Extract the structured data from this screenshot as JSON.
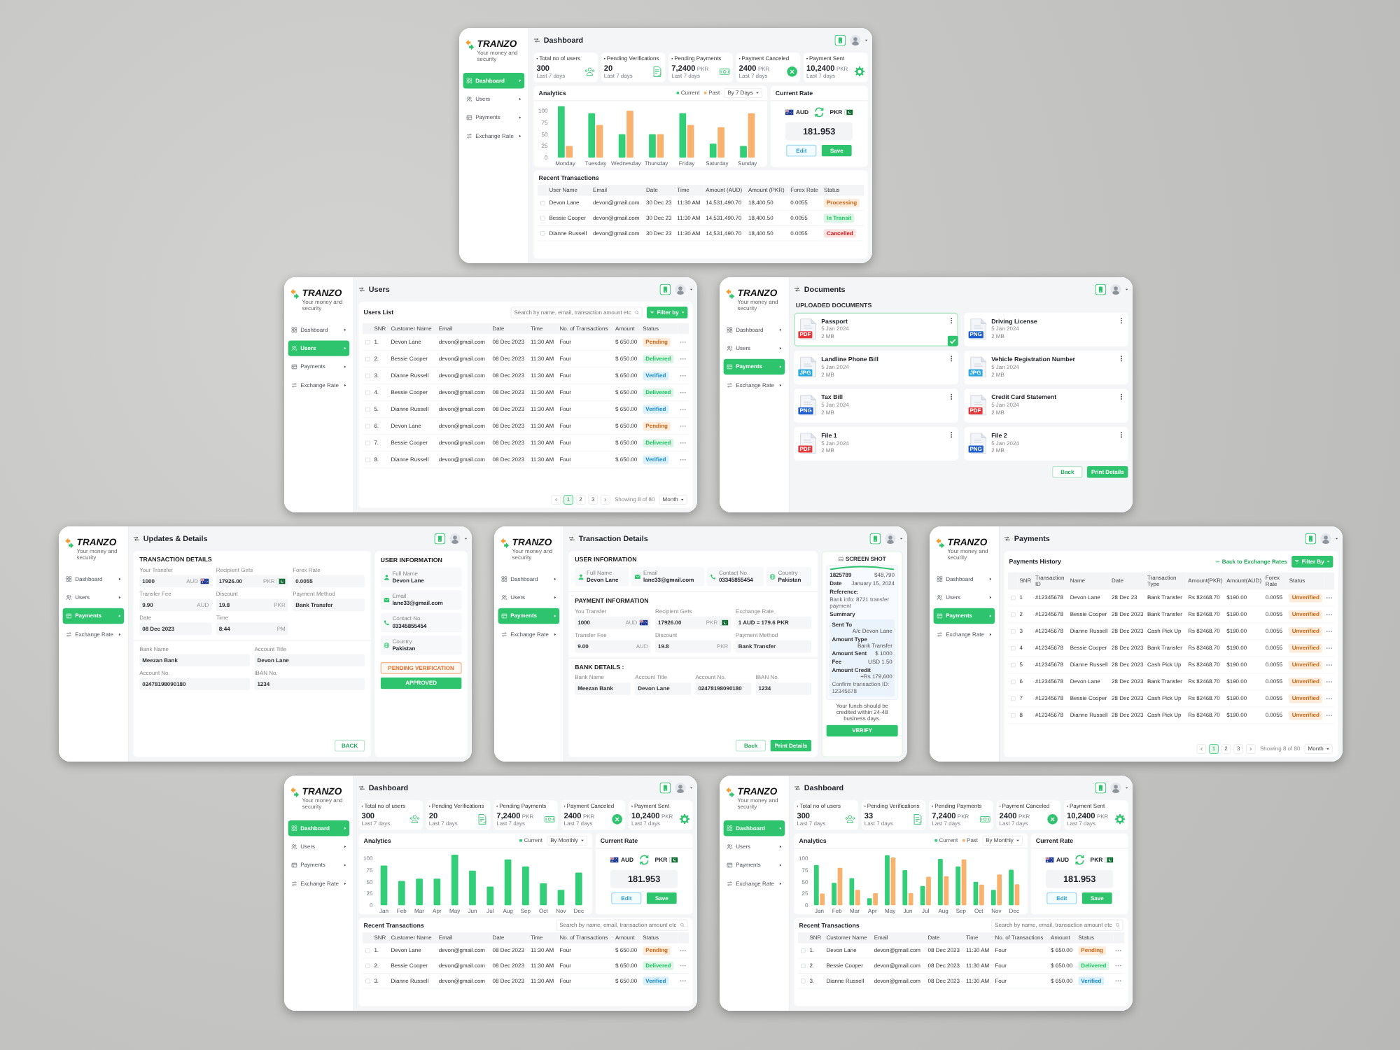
{
  "screen_rows": [
    [
      {
        "kind": "dashboard",
        "logo": {
          "name": "TRANZO",
          "tagline": "Your money and security"
        },
        "sidebar": [
          {
            "label": "Dashboard",
            "selected": true
          },
          {
            "label": "Users",
            "selected": false
          },
          {
            "label": "Payments",
            "selected": false
          },
          {
            "label": "Exchange Rate",
            "selected": false
          }
        ],
        "title": "Dashboard",
        "stats": [
          {
            "label": "Total no of users",
            "value": "300",
            "note": "Last 7 days"
          },
          {
            "label": "Pending Verifications",
            "value": "20",
            "note": "Last 7 days"
          },
          {
            "label": "Pending Payments",
            "value": "7,2400",
            "unit": "PKR",
            "note": "Last 7 days"
          },
          {
            "label": "Payment Canceled",
            "value": "2400",
            "unit": "PKR",
            "note": "Last 7 days"
          },
          {
            "label": "Payment Sent",
            "value": "10,2400",
            "unit": "PKR",
            "note": "Last 7 days"
          }
        ],
        "analytics": {
          "title": "Analytics",
          "period": "By 7 Days",
          "chart_data": {
            "type": "bar",
            "categories": [
              "Monday",
              "Tuesday",
              "Wednesday",
              "Thursday",
              "Friday",
              "Saturday",
              "Sunday"
            ],
            "series": [
              {
                "name": "Current",
                "color": "#33cf78",
                "values": [
                  110,
                  95,
                  50,
                  50,
                  95,
                  30,
                  25
                ]
              },
              {
                "name": "Past",
                "color": "#f9b26e",
                "values": [
                  25,
                  70,
                  100,
                  50,
                  70,
                  65,
                  95
                ]
              }
            ],
            "yticks": [
              0,
              25,
              50,
              75,
              100
            ],
            "ylim": [
              0,
              110
            ]
          }
        },
        "rate": {
          "title": "Current Rate",
          "from": "AUD",
          "to": "PKR",
          "value": "181.953",
          "buttons": [
            {
              "label": "Edit",
              "kind": "secondary"
            },
            {
              "label": "Save",
              "kind": "primary"
            }
          ]
        },
        "transactions": {
          "title": "Recent Transactions",
          "columns": [
            "User Name",
            "Email",
            "Date",
            "Time",
            "Amount (AUD)",
            "Amount (PKR)",
            "Forex Rate",
            "Status"
          ],
          "rows": [
            {
              "checked": false,
              "cells": [
                "Devon Lane",
                "devon@gmail.com",
                "30 Dec 23",
                "11:30 AM",
                "14,531,490.70",
                "18,400.50",
                "0.0055"
              ],
              "status": {
                "label": "Processing",
                "color": "#fdebdb"
              }
            },
            {
              "checked": false,
              "cells": [
                "Bessie Cooper",
                "devon@gmail.com",
                "30 Dec 23",
                "11:30 AM",
                "14,531,490.70",
                "18,400.50",
                "0.0055"
              ],
              "status": {
                "label": "In Transit",
                "color": "#dcf5e6"
              }
            },
            {
              "checked": false,
              "cells": [
                "Dianne Russell",
                "devon@gmail.com",
                "30 Dec 23",
                "11:30 AM",
                "14,531,490.70",
                "18,400.50",
                "0.0055"
              ],
              "status": {
                "label": "Cancelled",
                "color": "#fde2e2"
              }
            }
          ]
        }
      }
    ],
    [
      {
        "kind": "table",
        "logo": {
          "name": "TRANZO",
          "tagline": "Your money and security"
        },
        "sidebar": [
          {
            "label": "Dashboard",
            "selected": false
          },
          {
            "label": "Users",
            "selected": true
          },
          {
            "label": "Payments",
            "selected": false
          },
          {
            "label": "Exchange Rate",
            "selected": false
          }
        ],
        "title": "Users",
        "table": {
          "title": "Users List",
          "search": {
            "placeholder": "Search by name, email, transaction amount etc"
          },
          "filter": "Filter by",
          "columns": [
            "SNR",
            "Customer Name",
            "Email",
            "Date",
            "Time",
            "No. of Transactions",
            "Amount",
            "Status"
          ],
          "rows": [
            {
              "checked": false,
              "cells": [
                "1.",
                "Devon Lane",
                "devon@gmail.com",
                "08 Dec 2023",
                "11:30 AM",
                "Four",
                "$ 650.00"
              ],
              "status": {
                "label": "Pending",
                "color": "#fdebdb"
              }
            },
            {
              "checked": false,
              "cells": [
                "2.",
                "Bessie Cooper",
                "devon@gmail.com",
                "08 Dec 2023",
                "11:30 AM",
                "Four",
                "$ 650.00"
              ],
              "status": {
                "label": "Delivered",
                "color": "#dcf5e6"
              }
            },
            {
              "checked": false,
              "cells": [
                "3.",
                "Dianne Russell",
                "devon@gmail.com",
                "08 Dec 2023",
                "11:30 AM",
                "Four",
                "$ 650.00"
              ],
              "status": {
                "label": "Verified",
                "color": "#dcf0fb"
              }
            },
            {
              "checked": false,
              "cells": [
                "4.",
                "Bessie Cooper",
                "devon@gmail.com",
                "08 Dec 2023",
                "11:30 AM",
                "Four",
                "$ 650.00"
              ],
              "status": {
                "label": "Delivered",
                "color": "#dcf5e6"
              }
            },
            {
              "checked": false,
              "cells": [
                "5.",
                "Dianne Russell",
                "devon@gmail.com",
                "08 Dec 2023",
                "11:30 AM",
                "Four",
                "$ 650.00"
              ],
              "status": {
                "label": "Verified",
                "color": "#dcf0fb"
              }
            },
            {
              "checked": false,
              "cells": [
                "6.",
                "Devon Lane",
                "devon@gmail.com",
                "08 Dec 2023",
                "11:30 AM",
                "Four",
                "$ 650.00"
              ],
              "status": {
                "label": "Pending",
                "color": "#fdebdb"
              }
            },
            {
              "checked": false,
              "cells": [
                "7.",
                "Bessie Cooper",
                "devon@gmail.com",
                "08 Dec 2023",
                "11:30 AM",
                "Four",
                "$ 650.00"
              ],
              "status": {
                "label": "Delivered",
                "color": "#dcf5e6"
              }
            },
            {
              "checked": false,
              "cells": [
                "8.",
                "Dianne Russell",
                "devon@gmail.com",
                "08 Dec 2023",
                "11:30 AM",
                "Four",
                "$ 650.00"
              ],
              "status": {
                "label": "Verified",
                "color": "#dcf0fb"
              }
            }
          ],
          "pagination": {
            "pages": [
              {
                "label": "1",
                "selected": true
              },
              {
                "label": "2",
                "selected": false
              },
              {
                "label": "3",
                "selected": false
              }
            ],
            "summary": "Showing 8 of 80",
            "per_page": "Month"
          }
        }
      },
      {
        "kind": "documents",
        "logo": {
          "name": "TRANZO",
          "tagline": "Your money and security"
        },
        "sidebar": [
          {
            "label": "Dashboard",
            "selected": false
          },
          {
            "label": "Users",
            "selected": false
          },
          {
            "label": "Payments",
            "selected": true
          },
          {
            "label": "Exchange Rate",
            "selected": false
          }
        ],
        "title": "Documents",
        "section": "UPLOADED DOCUMENTS",
        "documents": [
          {
            "name": "Passport",
            "date": "5 Jan 2024",
            "size": "2 MB",
            "type": "PDF",
            "color": "#e5383b",
            "selected": true
          },
          {
            "name": "Driving License",
            "date": "5 Jan 2024",
            "size": "2 MB",
            "type": "PNG",
            "color": "#1d5fd0",
            "selected": false
          },
          {
            "name": "Landline Phone Bill",
            "date": "5 Jan 2024",
            "size": "2 MB",
            "type": "JPG",
            "color": "#2aa8e0",
            "selected": false
          },
          {
            "name": "Vehicle Registration Number",
            "date": "5 Jan 2024",
            "size": "2 MB",
            "type": "JPG",
            "color": "#2aa8e0",
            "selected": false
          },
          {
            "name": "Tax Bill",
            "date": "5 Jan 2024",
            "size": "2 MB",
            "type": "PNG",
            "color": "#1d5fd0",
            "selected": false
          },
          {
            "name": "Credit Card Statement",
            "date": "5 Jan 2024",
            "size": "2 MB",
            "type": "PDF",
            "color": "#e5383b",
            "selected": false
          },
          {
            "name": "File 1",
            "date": "5 Jan 2024",
            "size": "2 MB",
            "type": "PDF",
            "color": "#e5383b",
            "selected": false
          },
          {
            "name": "File 2",
            "date": "5 Jan 2024",
            "size": "2 MB",
            "type": "PNG",
            "color": "#1d5fd0",
            "selected": false
          }
        ],
        "buttons": [
          {
            "label": "Back",
            "kind": "outline"
          },
          {
            "label": "Print Details",
            "kind": "primary"
          }
        ]
      }
    ],
    [
      {
        "kind": "details",
        "logo": {
          "name": "TRANZO",
          "tagline": "Your money and security"
        },
        "sidebar": [
          {
            "label": "Dashboard",
            "selected": false
          },
          {
            "label": "Users",
            "selected": false
          },
          {
            "label": "Payments",
            "selected": true
          },
          {
            "label": "Exchange Rate",
            "selected": false
          }
        ],
        "title": "Updates & Details",
        "transaction_details": {
          "title": "TRANSACTION DETAILS",
          "fields": [
            {
              "kind": "australia",
              "label": "Your Transfer",
              "value": "1000",
              "unit": "AUD"
            },
            {
              "kind": "pakistan",
              "label": "Recipient Gets",
              "value": "17926.00",
              "unit": "PKR"
            },
            {
              "kind": "plain",
              "label": "Forex Rate",
              "value": "0.0055"
            },
            {
              "kind": "plain",
              "label": "Transfer Fee",
              "value": "9.90",
              "unit": "AUD"
            },
            {
              "kind": "plain",
              "label": "Discount",
              "value": "19.8",
              "unit": "PKR"
            },
            {
              "kind": "plain",
              "label": "Payment Method",
              "value": "Bank Transfer"
            },
            {
              "kind": "plain",
              "label": "Date",
              "value": "08 Dec 2023"
            },
            {
              "kind": "plain",
              "label": "Time",
              "value": "8:44",
              "unit": "PM"
            }
          ]
        },
        "bank": {
          "fields": [
            {
              "label": "Bank Name",
              "value": "Meezan Bank"
            },
            {
              "label": "Account Title",
              "value": "Devon Lane"
            },
            {
              "label": "Account No.",
              "value": "02478198090180"
            },
            {
              "label": "IBAN No.",
              "value": "1234"
            }
          ]
        },
        "back": {
          "label": "BACK",
          "kind": "outline"
        },
        "user": {
          "title": "USER INFORMATION",
          "fields": [
            {
              "label": "Full Name",
              "value": "Devon Lane"
            },
            {
              "label": "Email",
              "value": "lane33@gmail.com"
            },
            {
              "label": "Contact No.",
              "value": "03345855454"
            },
            {
              "label": "Country",
              "value": "Pakistan"
            }
          ],
          "buttons": [
            {
              "label": "PENDING VERIFICATION",
              "kind": "warning"
            },
            {
              "label": "APPROVED",
              "kind": "primary"
            }
          ]
        }
      },
      {
        "kind": "transaction",
        "logo": {
          "name": "TRANZO",
          "tagline": "Your money and security"
        },
        "sidebar": [
          {
            "label": "Dashboard",
            "selected": false
          },
          {
            "label": "Users",
            "selected": false
          },
          {
            "label": "Payments",
            "selected": true
          },
          {
            "label": "Exchange Rate",
            "selected": false
          }
        ],
        "title": "Transaction Details",
        "user": {
          "title": "USER INFORMATION",
          "fields": [
            {
              "label": "Full Name",
              "value": "Devon Lane"
            },
            {
              "label": "Email",
              "value": "lane33@gmail.com"
            },
            {
              "label": "Contact No.",
              "value": "03345855454"
            },
            {
              "label": "Country",
              "value": "Pakistan"
            }
          ]
        },
        "payment": {
          "title": "PAYMENT INFORMATION",
          "fields": [
            {
              "kind": "australia",
              "label": "You Transfer",
              "value": "1000",
              "unit": "AUD"
            },
            {
              "kind": "pakistan",
              "label": "Recipient Gets",
              "value": "17926.00",
              "unit": "PKR"
            },
            {
              "kind": "plain",
              "label": "Exchange Rate",
              "value": "1 AUD = 179.6 PKR"
            },
            {
              "kind": "plain",
              "label": "Transfer Fee",
              "value": "9.00",
              "unit": "AUD"
            },
            {
              "kind": "plain",
              "label": "Discount",
              "value": "19.8",
              "unit": "PKR"
            },
            {
              "kind": "plain",
              "label": "Payment Method",
              "value": "Bank Transfer"
            }
          ]
        },
        "bank": {
          "title": "BANK DETAILS :",
          "fields": [
            {
              "label": "Bank Name",
              "value": "Meezan Bank"
            },
            {
              "label": "Account Title",
              "value": "Devon Lane"
            },
            {
              "label": "Account No.",
              "value": "02478198090180"
            },
            {
              "label": "IBAN No.",
              "value": "1234"
            }
          ]
        },
        "buttons": [
          {
            "label": "Back",
            "kind": "outline"
          },
          {
            "label": "Print Details",
            "kind": "primary"
          }
        ],
        "receipt": {
          "title": "SCREEN SHOT",
          "head": [
            {
              "label": "1825789",
              "value": "$48,790"
            },
            {
              "label": "Date",
              "value": "January 15, 2024"
            }
          ],
          "reference": {
            "label": "Reference:",
            "text": "Bank info: 8721 transfer payment"
          },
          "summary_title": "Summary",
          "summary": [
            {
              "label": "Sent To",
              "value": "A/c Devon Lane"
            },
            {
              "label": "Amount Type",
              "value": "Bank Transfer"
            },
            {
              "label": "Amount Sent",
              "value": "$ 1000"
            },
            {
              "label": "Fee",
              "value": "USD 1.50"
            },
            {
              "label": "Amount Credit",
              "value": "+Rs 179,600"
            }
          ],
          "note": "Confirm transaction ID: 12345678",
          "footer": "Your funds should be credited within 24-48 business days.",
          "button": "VERIFY"
        }
      },
      {
        "kind": "table",
        "logo": {
          "name": "TRANZO",
          "tagline": "Your money and security"
        },
        "sidebar": [
          {
            "label": "Dashboard",
            "selected": false
          },
          {
            "label": "Users",
            "selected": false
          },
          {
            "label": "Payments",
            "selected": true
          },
          {
            "label": "Exchange Rate",
            "selected": false
          }
        ],
        "title": "Payments",
        "table": {
          "title": "Payments History",
          "link": "Back to Exchange Rates",
          "filter": "Filter By",
          "columns": [
            "SNR",
            "Transaction ID",
            "Name",
            "Date",
            "Transaction Type",
            "Amount(PKR)",
            "Amount(AUD)",
            "Forex Rate",
            "Status"
          ],
          "rows": [
            {
              "checked": false,
              "cells": [
                "1",
                "#12345678",
                "Devon Lane",
                "28 Dec 23",
                "Bank Transfer",
                "Rs 82468.70",
                "$190.00",
                "0.0055"
              ],
              "status": {
                "label": "Unverified",
                "color": "#fdebdb"
              }
            },
            {
              "checked": false,
              "cells": [
                "2",
                "#12345678",
                "Bessie Cooper",
                "28 Dec 2023",
                "Bank Transfer",
                "Rs 82468.70",
                "$190.00",
                "0.0055"
              ],
              "status": {
                "label": "Unverified",
                "color": "#fdebdb"
              }
            },
            {
              "checked": false,
              "cells": [
                "3",
                "#12345678",
                "Dianne Russell",
                "28 Dec 2023",
                "Cash Pick Up",
                "Rs 82468.70",
                "$190.00",
                "0.0055"
              ],
              "status": {
                "label": "Unverified",
                "color": "#fdebdb"
              }
            },
            {
              "checked": false,
              "cells": [
                "4",
                "#12345678",
                "Bessie Cooper",
                "28 Dec 2023",
                "Bank Transfer",
                "Rs 82468.70",
                "$190.00",
                "0.0055"
              ],
              "status": {
                "label": "Unverified",
                "color": "#fdebdb"
              }
            },
            {
              "checked": false,
              "cells": [
                "5",
                "#12345678",
                "Dianne Russell",
                "28 Dec 2023",
                "Cash Pick Up",
                "Rs 82468.70",
                "$190.00",
                "0.0055"
              ],
              "status": {
                "label": "Unverified",
                "color": "#fdebdb"
              }
            },
            {
              "checked": false,
              "cells": [
                "6",
                "#12345678",
                "Devon Lane",
                "28 Dec 2023",
                "Bank Transfer",
                "Rs 82468.70",
                "$190.00",
                "0.0055"
              ],
              "status": {
                "label": "Unverified",
                "color": "#fdebdb"
              }
            },
            {
              "checked": false,
              "cells": [
                "7",
                "#12345678",
                "Bessie Cooper",
                "28 Dec 2023",
                "Cash Pick Up",
                "Rs 82468.70",
                "$190.00",
                "0.0055"
              ],
              "status": {
                "label": "Unverified",
                "color": "#fdebdb"
              }
            },
            {
              "checked": false,
              "cells": [
                "8",
                "#12345678",
                "Dianne Russell",
                "28 Dec 2023",
                "Cash Pick Up",
                "Rs 82468.70",
                "$190.00",
                "0.0055"
              ],
              "status": {
                "label": "Unverified",
                "color": "#fdebdb"
              }
            }
          ],
          "pagination": {
            "pages": [
              {
                "label": "1",
                "selected": true
              },
              {
                "label": "2",
                "selected": false
              },
              {
                "label": "3",
                "selected": false
              }
            ],
            "summary": "Showing 8 of 80",
            "per_page": "Month"
          }
        }
      }
    ],
    [
      {
        "kind": "dashboard",
        "logo": {
          "name": "TRANZO",
          "tagline": "Your money and security"
        },
        "sidebar": [
          {
            "label": "Dashboard",
            "selected": true
          },
          {
            "label": "Users",
            "selected": false
          },
          {
            "label": "Payments",
            "selected": false
          },
          {
            "label": "Exchange Rate",
            "selected": false
          }
        ],
        "title": "Dashboard",
        "stats": [
          {
            "label": "Total no of users",
            "value": "300",
            "note": "Last 7 days"
          },
          {
            "label": "Pending Verifications",
            "value": "20",
            "note": "Last 7 days"
          },
          {
            "label": "Pending Payments",
            "value": "7,2400",
            "unit": "PKR",
            "note": "Last 7 days"
          },
          {
            "label": "Payment Canceled",
            "value": "2400",
            "unit": "PKR",
            "note": "Last 7 days"
          },
          {
            "label": "Payment Sent",
            "value": "10,2400",
            "unit": "PKR",
            "note": "Last 7 days"
          }
        ],
        "analytics": {
          "title": "Analytics",
          "period": "By Monthly",
          "chart_data": {
            "type": "bar",
            "categories": [
              "Jan",
              "Feb",
              "Mar",
              "Apr",
              "May",
              "Jun",
              "Jul",
              "Aug",
              "Sep",
              "Oct",
              "Nov",
              "Dec"
            ],
            "series": [
              {
                "name": "Current",
                "color": "#33cf78",
                "values": [
                  85,
                  52,
                  57,
                  57,
                  108,
                  74,
                  40,
                  98,
                  83,
                  47,
                  33,
                  70
                ]
              }
            ],
            "yticks": [
              0,
              25,
              50,
              75,
              100
            ],
            "ylim": [
              0,
              110
            ]
          }
        },
        "rate": {
          "title": "Current Rate",
          "from": "AUD",
          "to": "PKR",
          "value": "181.953",
          "buttons": [
            {
              "label": "Edit",
              "kind": "secondary"
            },
            {
              "label": "Save",
              "kind": "primary"
            }
          ]
        },
        "transactions": {
          "title": "Recent Transactions",
          "search": {
            "placeholder": "Search by name, email, transaction amount etc"
          },
          "columns": [
            "SNR",
            "Customer Name",
            "Email",
            "Date",
            "Time",
            "No. of Transactions",
            "Amount",
            "Status"
          ],
          "rows": [
            {
              "checked": false,
              "cells": [
                "1.",
                "Devon Lane",
                "devon@gmail.com",
                "08 Dec 2023",
                "11:30 AM",
                "Four",
                "$ 650.00"
              ],
              "status": {
                "label": "Pending",
                "color": "#fdebdb"
              }
            },
            {
              "checked": false,
              "cells": [
                "2.",
                "Bessie Cooper",
                "devon@gmail.com",
                "08 Dec 2023",
                "11:30 AM",
                "Four",
                "$ 650.00"
              ],
              "status": {
                "label": "Delivered",
                "color": "#dcf5e6"
              }
            },
            {
              "checked": false,
              "cells": [
                "3.",
                "Dianne Russell",
                "devon@gmail.com",
                "08 Dec 2023",
                "11:30 AM",
                "Four",
                "$ 650.00"
              ],
              "status": {
                "label": "Verified",
                "color": "#dcf0fb"
              }
            }
          ]
        }
      },
      {
        "kind": "dashboard",
        "logo": {
          "name": "TRANZO",
          "tagline": "Your money and security"
        },
        "sidebar": [
          {
            "label": "Dashboard",
            "selected": true
          },
          {
            "label": "Users",
            "selected": false
          },
          {
            "label": "Payments",
            "selected": false
          },
          {
            "label": "Exchange Rate",
            "selected": false
          }
        ],
        "title": "Dashboard",
        "stats": [
          {
            "label": "Total no of users",
            "value": "300",
            "note": "Last 7 days"
          },
          {
            "label": "Pending Verifications",
            "value": "33",
            "note": "Last 7 days"
          },
          {
            "label": "Pending Payments",
            "value": "7,2400",
            "unit": "PKR",
            "note": "Last 7 days"
          },
          {
            "label": "Payment Canceled",
            "value": "2400",
            "unit": "PKR",
            "note": "Last 7 days"
          },
          {
            "label": "Payment Sent",
            "value": "10,2400",
            "unit": "PKR",
            "note": "Last 7 days"
          }
        ],
        "analytics": {
          "title": "Analytics",
          "period": "By Monthly",
          "chart_data": {
            "type": "bar",
            "categories": [
              "Jan",
              "Feb",
              "Mar",
              "Apr",
              "May",
              "Jun",
              "Jul",
              "Aug",
              "Sep",
              "Oct",
              "Nov",
              "Dec"
            ],
            "series": [
              {
                "name": "Current",
                "color": "#33cf78",
                "values": [
                  86,
                  48,
                  58,
                  15,
                  107,
                  75,
                  41,
                  99,
                  83,
                  50,
                  33,
                  76
                ]
              },
              {
                "name": "Past",
                "color": "#f9b26e",
                "values": [
                  25,
                  80,
                  33,
                  26,
                  102,
                  26,
                  61,
                  62,
                  98,
                  44,
                  66,
                  45
                ]
              }
            ],
            "yticks": [
              0,
              25,
              50,
              75,
              100
            ],
            "ylim": [
              0,
              110
            ]
          }
        },
        "rate": {
          "title": "Current Rate",
          "from": "AUD",
          "to": "PKR",
          "value": "181.953",
          "buttons": [
            {
              "label": "Edit",
              "kind": "secondary"
            },
            {
              "label": "Save",
              "kind": "primary"
            }
          ]
        },
        "transactions": {
          "title": "Recent Transactions",
          "search": {
            "placeholder": "Search by name, email, transaction amount etc"
          },
          "columns": [
            "SNR",
            "Customer Name",
            "Email",
            "Date",
            "Time",
            "No. of Transactions",
            "Amount",
            "Status"
          ],
          "rows": [
            {
              "checked": false,
              "cells": [
                "1.",
                "Devon Lane",
                "devon@gmail.com",
                "08 Dec 2023",
                "11:30 AM",
                "Four",
                "$ 650.00"
              ],
              "status": {
                "label": "Pending",
                "color": "#fdebdb"
              }
            },
            {
              "checked": false,
              "cells": [
                "2.",
                "Bessie Cooper",
                "devon@gmail.com",
                "08 Dec 2023",
                "11:30 AM",
                "Four",
                "$ 650.00"
              ],
              "status": {
                "label": "Delivered",
                "color": "#dcf5e6"
              }
            },
            {
              "checked": false,
              "cells": [
                "3.",
                "Dianne Russell",
                "devon@gmail.com",
                "08 Dec 2023",
                "11:30 AM",
                "Four",
                "$ 650.00"
              ],
              "status": {
                "label": "Verified",
                "color": "#dcf0fb"
              }
            }
          ]
        }
      }
    ]
  ]
}
